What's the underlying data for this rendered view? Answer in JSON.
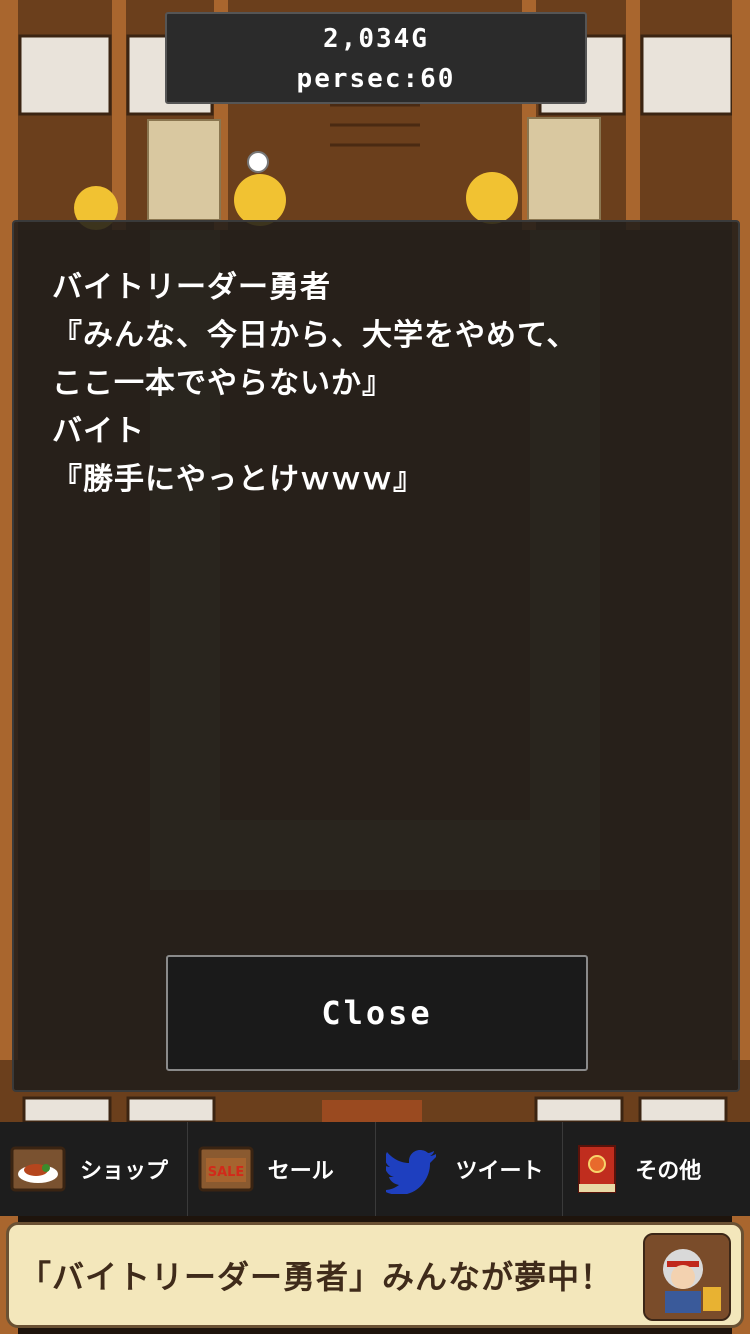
{
  "hud": {
    "gold": "2,034G",
    "persec": "persec:60"
  },
  "dialog": {
    "lines": [
      "バイトリーダー勇者",
      "『みんな、今日から、大学をやめて、",
      "ここ一本でやらないか』",
      "バイト",
      "『勝手にやっとけｗｗｗ』"
    ],
    "close_label": "Close"
  },
  "tabs": [
    {
      "label": "ショップ",
      "icon": "food-plate-icon"
    },
    {
      "label": "セール",
      "icon": "sale-sign-icon",
      "badge": "SALE"
    },
    {
      "label": "ツイート",
      "icon": "twitter-bird-icon"
    },
    {
      "label": "その他",
      "icon": "red-book-icon"
    }
  ],
  "ad": {
    "text": "「バイトリーダー勇者」みんなが夢中！"
  },
  "colors": {
    "hud_bg": "#2b2b2b",
    "dialog_bg": "#1e1c1a",
    "wood": "#7a4a22",
    "twitter_blue": "#1e3fbf",
    "ad_bg": "#f3e7bb"
  }
}
